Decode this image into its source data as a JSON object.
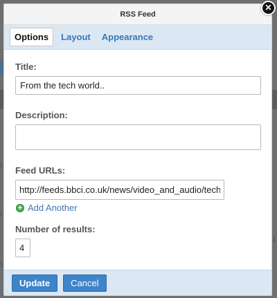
{
  "dialog": {
    "title": "RSS Feed",
    "close_icon": "close-icon"
  },
  "tabs": [
    {
      "label": "Options",
      "active": true
    },
    {
      "label": "Layout",
      "active": false
    },
    {
      "label": "Appearance",
      "active": false
    }
  ],
  "form": {
    "title_label": "Title:",
    "title_value": "From the tech world..",
    "description_label": "Description:",
    "description_value": "",
    "feed_urls_label": "Feed URLs:",
    "feed_url_value": "http://feeds.bbci.co.uk/news/video_and_audio/technology/rss.xml",
    "add_another_label": "Add Another",
    "add_icon": "plus-circle-icon",
    "num_results_label": "Number of results:",
    "num_results_value": "4"
  },
  "buttons": {
    "update_label": "Update",
    "cancel_label": "Cancel"
  },
  "colors": {
    "accent": "#3d84c9",
    "tab_bar": "#dbe8f4",
    "link": "#3a78b5",
    "add_icon": "#4caf50"
  }
}
